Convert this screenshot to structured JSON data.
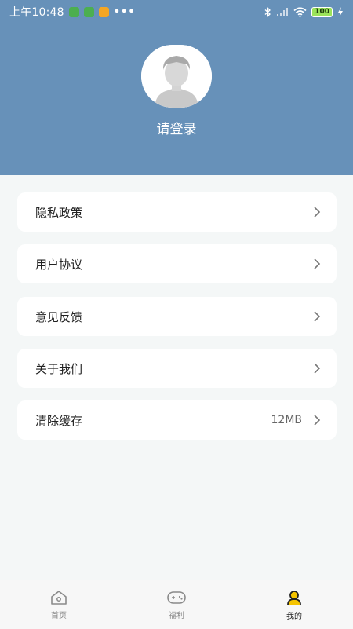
{
  "status_bar": {
    "time": "上午10:48",
    "more": "•••",
    "battery": "100"
  },
  "profile": {
    "login_label": "请登录"
  },
  "menu": {
    "items": [
      {
        "label": "隐私政策"
      },
      {
        "label": "用户协议"
      },
      {
        "label": "意见反馈"
      },
      {
        "label": "关于我们"
      },
      {
        "label": "清除缓存",
        "value": "12MB"
      }
    ]
  },
  "tab_bar": {
    "tabs": [
      {
        "label": "首页",
        "icon": "home-icon"
      },
      {
        "label": "福利",
        "icon": "gamepad-icon"
      },
      {
        "label": "我的",
        "icon": "user-icon",
        "active": true
      }
    ]
  },
  "colors": {
    "header": "#6791b9",
    "background": "#f4f7f7",
    "active_icon": "#f5c400"
  }
}
